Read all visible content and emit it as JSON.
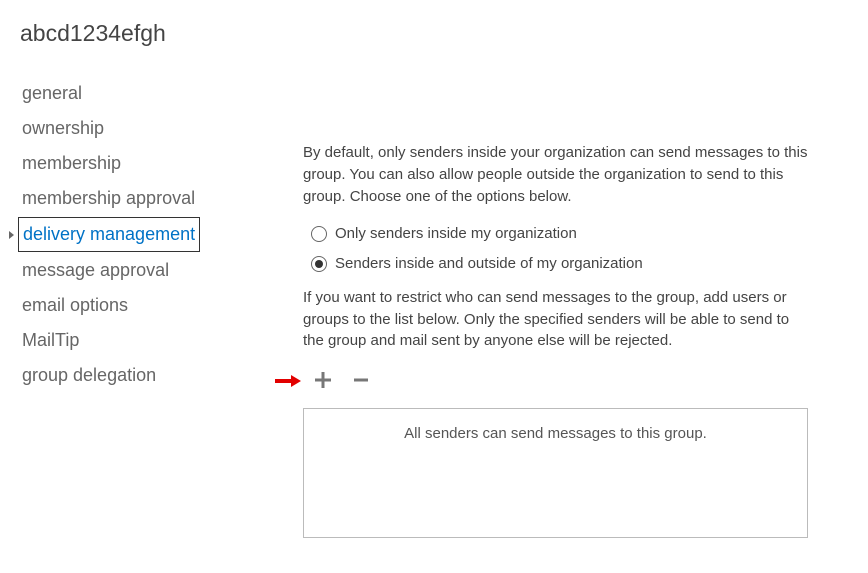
{
  "title": "abcd1234efgh",
  "sidebar": {
    "items": [
      {
        "label": "general"
      },
      {
        "label": "ownership"
      },
      {
        "label": "membership"
      },
      {
        "label": "membership approval"
      },
      {
        "label": "delivery management",
        "selected": true
      },
      {
        "label": "message approval"
      },
      {
        "label": "email options"
      },
      {
        "label": "MailTip"
      },
      {
        "label": "group delegation"
      }
    ]
  },
  "content": {
    "intro": "By default, only senders inside your organization can send messages to this group. You can also allow people outside the organization to send to this group. Choose one of the options below.",
    "radio_inside": "Only senders inside my organization",
    "radio_inside_outside": "Senders inside and outside of my organization",
    "restrict": "If you want to restrict who can send messages to the group, add users or groups to the list below. Only the specified senders will be able to send to the group and mail sent by anyone else will be rejected.",
    "list_placeholder": "All senders can send messages to this group."
  }
}
